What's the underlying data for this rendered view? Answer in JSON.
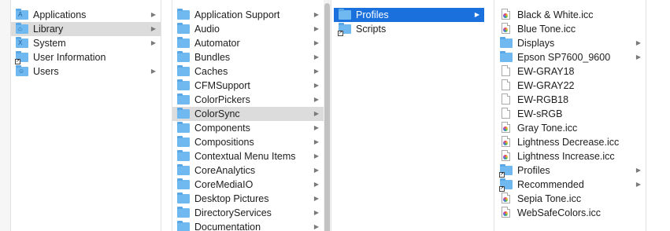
{
  "columns": [
    {
      "items": [
        {
          "label": "Applications",
          "icon": "applications-folder-icon",
          "glyph": "A",
          "type": "folder",
          "chevron": true,
          "selected": ""
        },
        {
          "label": "Library",
          "icon": "library-folder-icon",
          "glyph": "⌂",
          "type": "folder",
          "chevron": true,
          "selected": "grey"
        },
        {
          "label": "System",
          "icon": "system-folder-icon",
          "glyph": "X",
          "type": "folder",
          "chevron": true,
          "selected": ""
        },
        {
          "label": "User Information",
          "icon": "user-information-alias-icon",
          "glyph": "",
          "type": "alias-folder",
          "chevron": false,
          "selected": ""
        },
        {
          "label": "Users",
          "icon": "users-folder-icon",
          "glyph": "☺",
          "type": "folder",
          "chevron": true,
          "selected": ""
        }
      ]
    },
    {
      "items": [
        {
          "label": "Application Support",
          "icon": "folder-icon",
          "type": "folder",
          "chevron": true,
          "selected": ""
        },
        {
          "label": "Audio",
          "icon": "folder-icon",
          "type": "folder",
          "chevron": true,
          "selected": ""
        },
        {
          "label": "Automator",
          "icon": "folder-icon",
          "type": "folder",
          "chevron": true,
          "selected": ""
        },
        {
          "label": "Bundles",
          "icon": "folder-icon",
          "type": "folder",
          "chevron": true,
          "selected": ""
        },
        {
          "label": "Caches",
          "icon": "folder-icon",
          "type": "folder",
          "chevron": true,
          "selected": ""
        },
        {
          "label": "CFMSupport",
          "icon": "folder-icon",
          "type": "folder",
          "chevron": true,
          "selected": ""
        },
        {
          "label": "ColorPickers",
          "icon": "folder-icon",
          "type": "folder",
          "chevron": true,
          "selected": ""
        },
        {
          "label": "ColorSync",
          "icon": "folder-icon",
          "type": "folder",
          "chevron": true,
          "selected": "grey"
        },
        {
          "label": "Components",
          "icon": "folder-icon",
          "type": "folder",
          "chevron": true,
          "selected": ""
        },
        {
          "label": "Compositions",
          "icon": "folder-icon",
          "type": "folder",
          "chevron": true,
          "selected": ""
        },
        {
          "label": "Contextual Menu Items",
          "icon": "folder-icon",
          "type": "folder",
          "chevron": true,
          "selected": ""
        },
        {
          "label": "CoreAnalytics",
          "icon": "folder-icon",
          "type": "folder",
          "chevron": true,
          "selected": ""
        },
        {
          "label": "CoreMediaIO",
          "icon": "folder-icon",
          "type": "folder",
          "chevron": true,
          "selected": ""
        },
        {
          "label": "Desktop Pictures",
          "icon": "folder-icon",
          "type": "folder",
          "chevron": true,
          "selected": ""
        },
        {
          "label": "DirectoryServices",
          "icon": "folder-icon",
          "type": "folder",
          "chevron": true,
          "selected": ""
        },
        {
          "label": "Documentation",
          "icon": "folder-icon",
          "type": "folder",
          "chevron": true,
          "selected": ""
        }
      ]
    },
    {
      "items": [
        {
          "label": "Profiles",
          "icon": "folder-icon",
          "type": "folder",
          "chevron": true,
          "selected": "blue"
        },
        {
          "label": "Scripts",
          "icon": "scripts-alias-folder-icon",
          "type": "alias-folder",
          "chevron": false,
          "selected": ""
        }
      ]
    },
    {
      "items": [
        {
          "label": "Black & White.icc",
          "icon": "icc-profile-icon",
          "type": "doc-icc",
          "chevron": false,
          "selected": ""
        },
        {
          "label": "Blue Tone.icc",
          "icon": "icc-profile-icon",
          "type": "doc-icc",
          "chevron": false,
          "selected": ""
        },
        {
          "label": "Displays",
          "icon": "folder-icon",
          "type": "folder",
          "chevron": true,
          "selected": ""
        },
        {
          "label": "Epson SP7600_9600",
          "icon": "folder-icon",
          "type": "folder",
          "chevron": true,
          "selected": ""
        },
        {
          "label": "EW-GRAY18",
          "icon": "document-icon",
          "type": "doc",
          "chevron": false,
          "selected": ""
        },
        {
          "label": "EW-GRAY22",
          "icon": "document-icon",
          "type": "doc",
          "chevron": false,
          "selected": ""
        },
        {
          "label": "EW-RGB18",
          "icon": "document-icon",
          "type": "doc",
          "chevron": false,
          "selected": ""
        },
        {
          "label": "EW-sRGB",
          "icon": "document-icon",
          "type": "doc",
          "chevron": false,
          "selected": ""
        },
        {
          "label": "Gray Tone.icc",
          "icon": "icc-profile-icon",
          "type": "doc-icc",
          "chevron": false,
          "selected": ""
        },
        {
          "label": "Lightness Decrease.icc",
          "icon": "icc-profile-icon",
          "type": "doc-icc",
          "chevron": false,
          "selected": ""
        },
        {
          "label": "Lightness Increase.icc",
          "icon": "icc-profile-icon",
          "type": "doc-icc",
          "chevron": false,
          "selected": ""
        },
        {
          "label": "Profiles",
          "icon": "alias-folder-icon",
          "type": "alias-folder",
          "chevron": true,
          "selected": ""
        },
        {
          "label": "Recommended",
          "icon": "alias-folder-icon",
          "type": "alias-folder",
          "chevron": true,
          "selected": ""
        },
        {
          "label": "Sepia Tone.icc",
          "icon": "icc-profile-icon",
          "type": "doc-icc",
          "chevron": false,
          "selected": ""
        },
        {
          "label": "WebSafeColors.icc",
          "icon": "icc-profile-icon",
          "type": "doc-icc",
          "chevron": false,
          "selected": ""
        }
      ]
    }
  ],
  "chevron_glyph": "▶",
  "colors": {
    "selection_blue": "#1a71dd",
    "selection_grey": "#dcdcdc",
    "folder_blue": "#6fb8f0"
  }
}
